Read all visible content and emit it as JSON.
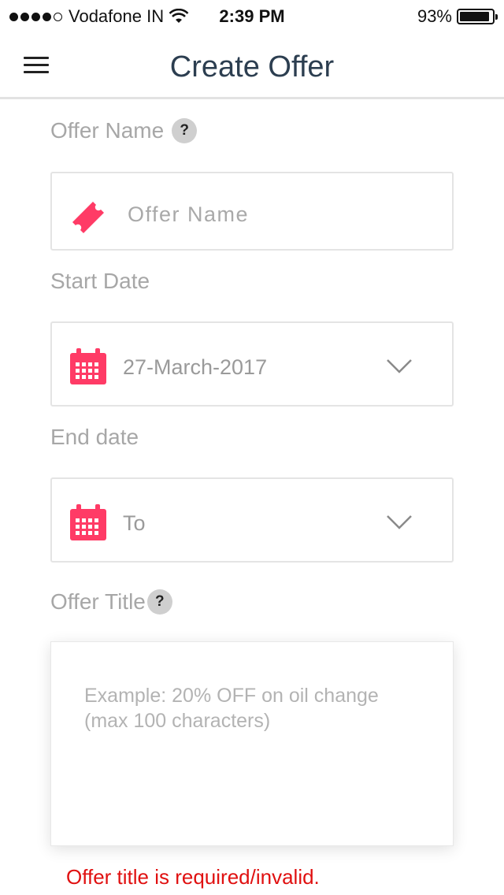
{
  "status_bar": {
    "carrier": "Vodafone IN",
    "time": "2:39 PM",
    "battery": "93%",
    "battery_level": 0.93
  },
  "header": {
    "title": "Create Offer",
    "menu_icon": "hamburger-menu-icon"
  },
  "form": {
    "offer_name": {
      "label": "Offer Name",
      "help": "?",
      "placeholder": "Offer Name",
      "icon": "ticket-icon"
    },
    "start_date": {
      "label": "Start Date",
      "value": "27-March-2017",
      "icon": "calendar-icon"
    },
    "end_date": {
      "label": "End date",
      "value": "To",
      "icon": "calendar-icon"
    },
    "offer_title": {
      "label": "Offer Title",
      "help": "?",
      "placeholder": "Example: 20% OFF on oil change (max 100 characters)",
      "error": "Offer title is required/invalid."
    }
  },
  "colors": {
    "accent": "#ff3b66",
    "title": "#2c3e50",
    "label": "#a7a7a7",
    "error": "#e01010"
  }
}
